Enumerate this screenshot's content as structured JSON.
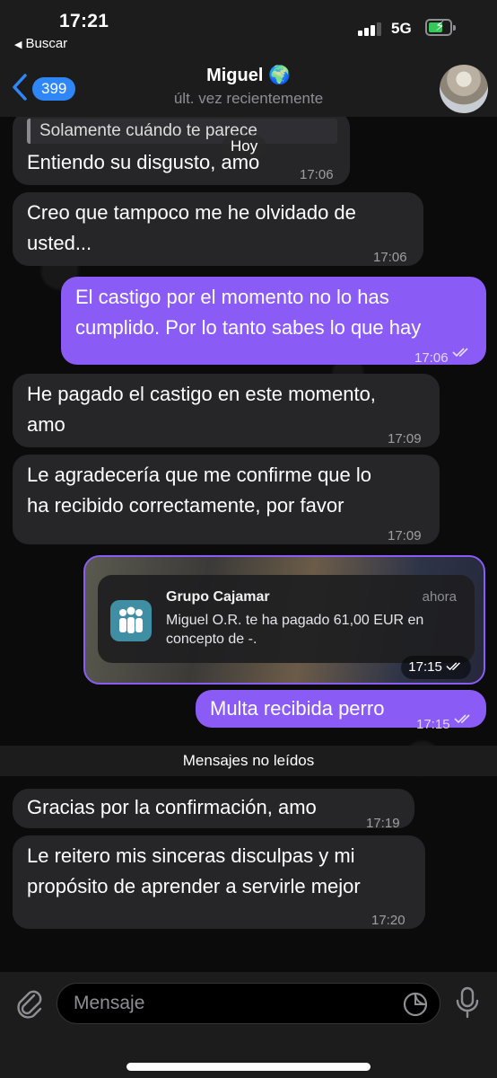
{
  "status_bar": {
    "time": "17:21",
    "back_app": "Buscar",
    "network": "5G"
  },
  "header": {
    "unread_count": "399",
    "title": "Miguel 🌍",
    "subtitle": "últ. vez recientemente"
  },
  "messages": [
    {
      "dir": "in",
      "reply_preview": "Solamente cuándo te parece",
      "text": "Entiendo su disgusto, amo",
      "time": "17:06"
    },
    {
      "dir": "in",
      "lines": [
        "Creo que tampoco me he olvidado de",
        "usted..."
      ],
      "time": "17:06"
    },
    {
      "dir": "out",
      "lines": [
        "El castigo por el momento no lo has",
        "cumplido. Por lo tanto sabes lo que hay"
      ],
      "time": "17:06",
      "read": true
    },
    {
      "dir": "in",
      "lines": [
        "He pagado el castigo en este momento,",
        "amo"
      ],
      "time": "17:09"
    },
    {
      "dir": "in",
      "lines": [
        "Le agradecería que me confirme que lo",
        "ha recibido correctamente, por favor"
      ],
      "time": "17:09"
    },
    {
      "dir": "out",
      "type": "image",
      "time": "17:15",
      "read": true,
      "notification": {
        "app": "Grupo Cajamar",
        "when": "ahora",
        "body": "Miguel O.R. te ha pagado 61,00 EUR en concepto de -."
      }
    },
    {
      "dir": "out",
      "text": "Multa recibida perro",
      "time": "17:15",
      "read": true
    },
    {
      "dir": "in",
      "text": "Gracias por la confirmación, amo",
      "time": "17:19"
    },
    {
      "dir": "in",
      "lines": [
        "Le reitero mis sinceras disculpas y mi",
        "propósito de aprender a servirle mejor"
      ],
      "time": "17:20"
    }
  ],
  "date_separator": "Hoy",
  "unread_divider": "Mensajes no leídos",
  "composer": {
    "placeholder": "Mensaje"
  },
  "colors": {
    "outgoing_bubble": "#8a5cf5",
    "incoming_bubble": "#262628",
    "badge": "#2f86f6",
    "battery": "#34c759"
  },
  "icons": [
    "back-chevron-icon",
    "signal-icon",
    "battery-icon",
    "paperclip-icon",
    "sticker-icon",
    "microphone-icon",
    "double-check-icon"
  ]
}
